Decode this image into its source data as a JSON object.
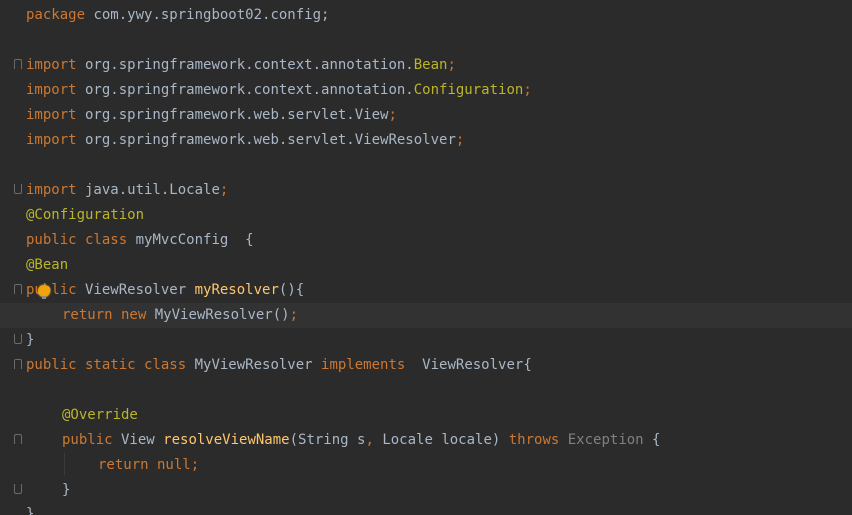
{
  "editor": {
    "lines": {
      "l1": {
        "kw": "package",
        "rest": " com.ywy.springboot02.config;"
      },
      "l3": {
        "kw": "import",
        "path": " org.springframework.context.annotation.",
        "cls": "Bean",
        "end": ";"
      },
      "l4": {
        "kw": "import",
        "path": " org.springframework.context.annotation.",
        "cls": "Configuration",
        "end": ";"
      },
      "l5": {
        "kw": "import",
        "path": " org.springframework.web.servlet.View",
        "end": ";"
      },
      "l6": {
        "kw": "import",
        "path": " org.springframework.web.servlet.ViewResolver",
        "end": ";"
      },
      "l8": {
        "kw": "import",
        "path": " java.util.Locale",
        "end": ";"
      },
      "l9": {
        "ann": "@Configuration"
      },
      "l10": {
        "kw": "public class",
        "rest": " myMvcConfig  {"
      },
      "l11": {
        "ann": "@Bean"
      },
      "l12": {
        "kw": "public",
        "type": " ViewResolver ",
        "fn": "myResolver",
        "rest": "(){"
      },
      "l13": {
        "kw1": "return",
        "kw2": " new",
        "rest": " MyViewResolver()",
        "end": ";"
      },
      "l14": {
        "rest": "}"
      },
      "l15": {
        "kw": "public static class",
        "rest": " MyViewResolver ",
        "kw2": "implements",
        "rest2": "  ViewResolver{"
      },
      "l17": {
        "ann": "@Override"
      },
      "l18": {
        "kw": "public",
        "type": " View ",
        "fn": "resolveViewName",
        "p1": "(String s",
        "comma": ",",
        "p2": " Locale locale) ",
        "kw2": "throws",
        "exc": " Exception",
        "rest": " {"
      },
      "l19": {
        "kw": "return",
        "kw2": " null",
        "end": ";"
      },
      "l20": {
        "rest": "}"
      },
      "l21": {
        "rest": "}"
      }
    }
  }
}
